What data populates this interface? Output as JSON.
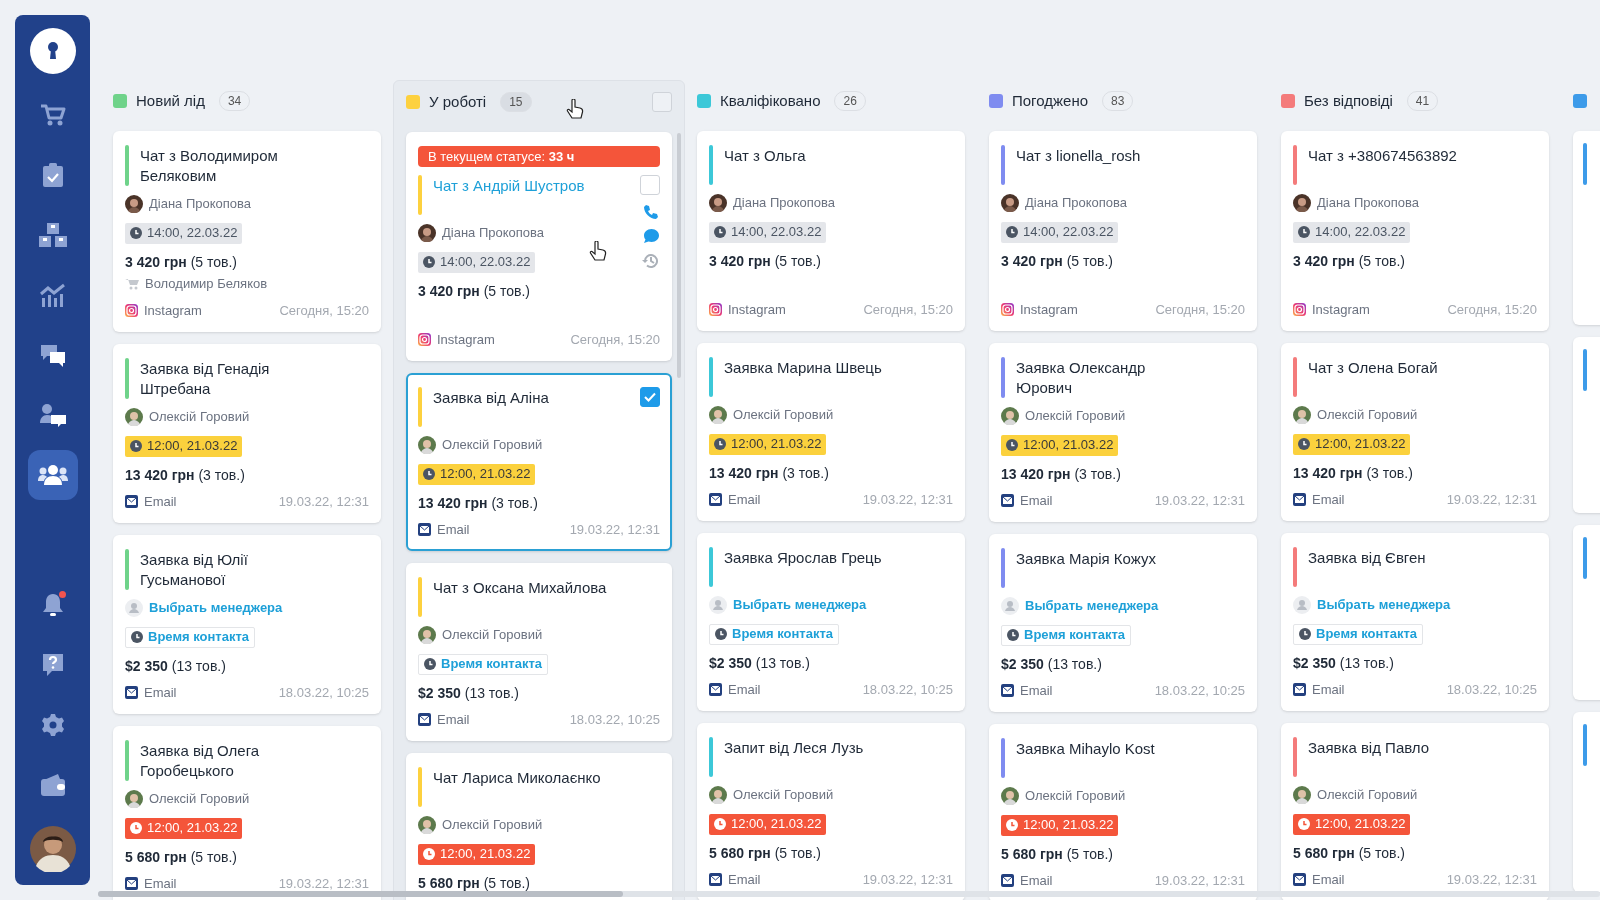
{
  "sidebar": {
    "items": [
      {
        "kind": "cart",
        "selected": false
      },
      {
        "kind": "tasks",
        "selected": false
      },
      {
        "kind": "boxes",
        "selected": false
      },
      {
        "kind": "chart",
        "selected": false
      },
      {
        "kind": "chats",
        "selected": false
      },
      {
        "kind": "contact",
        "selected": false
      },
      {
        "kind": "team",
        "selected": true
      }
    ],
    "bottom_items": [
      {
        "kind": "bell",
        "badge": true
      },
      {
        "kind": "help",
        "badge": false
      },
      {
        "kind": "settings",
        "badge": false
      },
      {
        "kind": "wallet",
        "badge": false
      }
    ]
  },
  "columns": [
    {
      "kind": "full",
      "name": "Новий лід",
      "count": "34",
      "color": "#6fd38a",
      "highlighted": false,
      "cards": [
        {
          "kind": "lead",
          "title": "Чат з Володимиром Беляковим",
          "link": false,
          "manager": {
            "name": "Діана Прокопова",
            "kind": "woman"
          },
          "time": {
            "text": "14:00, 22.03.22",
            "kind": "gray"
          },
          "price": "**3 420 грн** (5 тов.)",
          "buyer": "Володимир Беляков",
          "source": {
            "kind": "instagram",
            "label": "Instagram"
          },
          "date": "Сегодня, 15:20"
        },
        {
          "kind": "lead",
          "title": "Заявка від Генадія Штребана",
          "link": false,
          "manager": {
            "name": "Олексій Горовий",
            "kind": "man"
          },
          "time": {
            "text": "12:00, 21.03.22",
            "kind": "yellow"
          },
          "price": "**13 420 грн** (3 тов.)",
          "source": {
            "kind": "email",
            "label": "Email"
          },
          "date": "19.03.22, 12:31"
        },
        {
          "kind": "lead",
          "title": "Заявка від Юлії Гусьманової",
          "link": false,
          "manager": {
            "name": "Выбрать менеджера",
            "kind": "none"
          },
          "time": {
            "text": "Время контакта",
            "kind": "outline"
          },
          "price": "**$2 350** (13 тов.)",
          "source": {
            "kind": "email",
            "label": "Email"
          },
          "date": "18.03.22, 10:25"
        },
        {
          "kind": "lead",
          "title": "Заявка від Олега Горобецького",
          "link": false,
          "manager": {
            "name": "Олексій Горовий",
            "kind": "man"
          },
          "time": {
            "text": "12:00, 21.03.22",
            "kind": "red"
          },
          "price": "**5 680 грн** (5 тов.)",
          "source": {
            "kind": "email",
            "label": "Email"
          },
          "date": "19.03.22, 12:31"
        }
      ]
    },
    {
      "kind": "full",
      "name": "У роботі",
      "count": "15",
      "color": "#fdd13f",
      "highlighted": true,
      "header_checked": false,
      "cards": [
        {
          "kind": "lead",
          "banner": "В текущем статусе: **33 ч**",
          "title": "Чат з Андрій Шустров",
          "link": true,
          "checked": false,
          "actions": true,
          "manager": {
            "name": "Діана Прокопова",
            "kind": "woman"
          },
          "time": {
            "text": "14:00, 22.03.22",
            "kind": "gray"
          },
          "price": "**3 420 грн** (5 тов.)",
          "source": {
            "kind": "instagram",
            "label": "Instagram"
          },
          "date": "Сегодня, 15:20"
        },
        {
          "kind": "lead",
          "title": "Заявка від Аліна",
          "link": false,
          "checked": true,
          "manager": {
            "name": "Олексій Горовий",
            "kind": "man"
          },
          "time": {
            "text": "12:00, 21.03.22",
            "kind": "yellow"
          },
          "price": "**13 420 грн** (3 тов.)",
          "source": {
            "kind": "email",
            "label": "Email"
          },
          "date": "19.03.22, 12:31"
        },
        {
          "kind": "lead",
          "title": "Чат з Оксана Михайлова",
          "link": false,
          "manager": {
            "name": "Олексій Горовий",
            "kind": "man"
          },
          "time": {
            "text": "Время контакта",
            "kind": "outline"
          },
          "price": "**$2 350** (13 тов.)",
          "source": {
            "kind": "email",
            "label": "Email"
          },
          "date": "18.03.22, 10:25"
        },
        {
          "kind": "lead",
          "title": "Чат Лариса Миколаєнко",
          "link": false,
          "manager": {
            "name": "Олексій Горовий",
            "kind": "man"
          },
          "time": {
            "text": "12:00, 21.03.22",
            "kind": "red"
          },
          "price": "**5 680 грн** (5 тов.)"
        }
      ]
    },
    {
      "kind": "full",
      "name": "Кваліфіковано",
      "count": "26",
      "color": "#3cc8d8",
      "highlighted": false,
      "cards": [
        {
          "kind": "lead",
          "title": "Чат з Ольга",
          "link": false,
          "manager": {
            "name": "Діана Прокопова",
            "kind": "woman"
          },
          "time": {
            "text": "14:00, 22.03.22",
            "kind": "gray"
          },
          "price": "**3 420 грн** (5 тов.)",
          "source": {
            "kind": "instagram",
            "label": "Instagram"
          },
          "date": "Сегодня, 15:20"
        },
        {
          "kind": "lead",
          "title": "Заявка Марина Швець",
          "link": false,
          "manager": {
            "name": "Олексій Горовий",
            "kind": "man"
          },
          "time": {
            "text": "12:00, 21.03.22",
            "kind": "yellow"
          },
          "price": "**13 420 грн** (3 тов.)",
          "source": {
            "kind": "email",
            "label": "Email"
          },
          "date": "19.03.22, 12:31"
        },
        {
          "kind": "lead",
          "title": "Заявка Ярослав Грець",
          "link": false,
          "manager": {
            "name": "Выбрать менеджера",
            "kind": "none"
          },
          "time": {
            "text": "Время контакта",
            "kind": "outline"
          },
          "price": "**$2 350** (13 тов.)",
          "source": {
            "kind": "email",
            "label": "Email"
          },
          "date": "18.03.22, 10:25"
        },
        {
          "kind": "lead",
          "title": "Запит від Леся Лузь",
          "link": false,
          "manager": {
            "name": "Олексій Горовий",
            "kind": "man"
          },
          "time": {
            "text": "12:00, 21.03.22",
            "kind": "red"
          },
          "price": "**5 680 грн** (5 тов.)",
          "source": {
            "kind": "email",
            "label": "Email"
          },
          "date": "19.03.22, 12:31"
        }
      ]
    },
    {
      "kind": "full",
      "name": "Погоджено",
      "count": "83",
      "color": "#7f8cf0",
      "highlighted": false,
      "cards": [
        {
          "kind": "lead",
          "title": "Чат з lionella_rosh",
          "link": false,
          "manager": {
            "name": "Діана Прокопова",
            "kind": "woman"
          },
          "time": {
            "text": "14:00, 22.03.22",
            "kind": "gray"
          },
          "price": "**3 420 грн** (5 тов.)",
          "source": {
            "kind": "instagram",
            "label": "Instagram"
          },
          "date": "Сегодня, 15:20"
        },
        {
          "kind": "lead",
          "title": "Заявка Олександр Юрович",
          "link": false,
          "manager": {
            "name": "Олексій Горовий",
            "kind": "man"
          },
          "time": {
            "text": "12:00, 21.03.22",
            "kind": "yellow"
          },
          "price": "**13 420 грн** (3 тов.)",
          "source": {
            "kind": "email",
            "label": "Email"
          },
          "date": "19.03.22, 12:31"
        },
        {
          "kind": "lead",
          "title": "Заявка Марія Кожух",
          "link": false,
          "manager": {
            "name": "Выбрать менеджера",
            "kind": "none"
          },
          "time": {
            "text": "Время контакта",
            "kind": "outline"
          },
          "price": "**$2 350** (13 тов.)",
          "source": {
            "kind": "email",
            "label": "Email"
          },
          "date": "18.03.22, 10:25"
        },
        {
          "kind": "lead",
          "title": "Заявка Mihaylo Kost",
          "link": false,
          "manager": {
            "name": "Олексій Горовий",
            "kind": "man"
          },
          "time": {
            "text": "12:00, 21.03.22",
            "kind": "red"
          },
          "price": "**5 680 грн** (5 тов.)",
          "source": {
            "kind": "email",
            "label": "Email"
          },
          "date": "19.03.22, 12:31"
        }
      ]
    },
    {
      "kind": "full",
      "name": "Без відповіді",
      "count": "41",
      "color": "#f47b7b",
      "highlighted": false,
      "cards": [
        {
          "kind": "lead",
          "title": "Чат з +380674563892",
          "link": false,
          "manager": {
            "name": "Діана Прокопова",
            "kind": "woman"
          },
          "time": {
            "text": "14:00, 22.03.22",
            "kind": "gray"
          },
          "price": "**3 420 грн** (5 тов.)",
          "source": {
            "kind": "instagram",
            "label": "Instagram"
          },
          "date": "Сегодня, 15:20"
        },
        {
          "kind": "lead",
          "title": "Чат з Олена Богай",
          "link": false,
          "manager": {
            "name": "Олексій Горовий",
            "kind": "man"
          },
          "time": {
            "text": "12:00, 21.03.22",
            "kind": "yellow"
          },
          "price": "**13 420 грн** (3 тов.)",
          "source": {
            "kind": "email",
            "label": "Email"
          },
          "date": "19.03.22, 12:31"
        },
        {
          "kind": "lead",
          "title": "Заявка від Євген",
          "link": false,
          "manager": {
            "name": "Выбрать менеджера",
            "kind": "none"
          },
          "time": {
            "text": "Время контакта",
            "kind": "outline"
          },
          "price": "**$2 350** (13 тов.)",
          "source": {
            "kind": "email",
            "label": "Email"
          },
          "date": "18.03.22, 10:25"
        },
        {
          "kind": "lead",
          "title": "Заявка від Павло",
          "link": false,
          "manager": {
            "name": "Олексій Горовий",
            "kind": "man"
          },
          "time": {
            "text": "12:00, 21.03.22",
            "kind": "red"
          },
          "price": "**5 680 грн** (5 тов.)",
          "source": {
            "kind": "email",
            "label": "Email"
          },
          "date": "19.03.22, 12:31"
        }
      ]
    },
    {
      "kind": "stub",
      "color": "#3d9be9",
      "cards": [
        {
          "kind": "stub"
        },
        {
          "kind": "stub"
        },
        {
          "kind": "stub"
        },
        {
          "kind": "stub"
        }
      ]
    }
  ]
}
